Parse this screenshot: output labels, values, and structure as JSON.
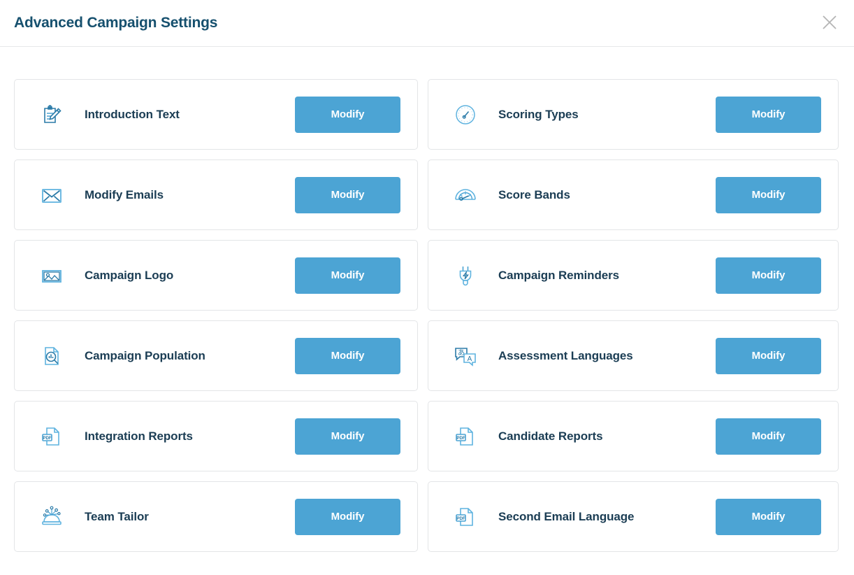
{
  "header": {
    "title": "Advanced Campaign Settings",
    "close_icon": "close-icon",
    "close_label": "Close"
  },
  "theme": {
    "title_color": "#16506e",
    "label_color": "#1b3d54",
    "button_bg": "#4ca4d4",
    "button_text": "#ffffff",
    "card_border": "#e3e5e7",
    "icon_color": "#4ca4d4",
    "icon_color_dark": "#2b7ba8",
    "close_color": "#b3b3b3"
  },
  "settings": {
    "button_label": "Modify",
    "left_column": [
      {
        "label": "Introduction Text",
        "icon": "clipboard-pencil-icon",
        "action": "Modify"
      },
      {
        "label": "Modify Emails",
        "icon": "envelope-icon",
        "action": "Modify"
      },
      {
        "label": "Campaign Logo",
        "icon": "image-icon",
        "action": "Modify"
      },
      {
        "label": "Campaign Population",
        "icon": "document-search-chart-icon",
        "action": "Modify"
      },
      {
        "label": "Integration Reports",
        "icon": "pdf-document-icon",
        "action": "Modify"
      },
      {
        "label": "Team Tailor",
        "icon": "pin-cushion-icon",
        "action": "Modify"
      }
    ],
    "right_column": [
      {
        "label": "Scoring Types",
        "icon": "gauge-circle-icon",
        "action": "Modify"
      },
      {
        "label": "Score Bands",
        "icon": "speedometer-icon",
        "action": "Modify"
      },
      {
        "label": "Campaign Reminders",
        "icon": "power-plug-bolt-icon",
        "action": "Modify"
      },
      {
        "label": "Assessment Languages",
        "icon": "translate-bubbles-icon",
        "action": "Modify"
      },
      {
        "label": "Candidate Reports",
        "icon": "pdf-document-icon",
        "action": "Modify"
      },
      {
        "label": "Second Email Language",
        "icon": "pdf-document-icon",
        "action": "Modify"
      }
    ]
  }
}
